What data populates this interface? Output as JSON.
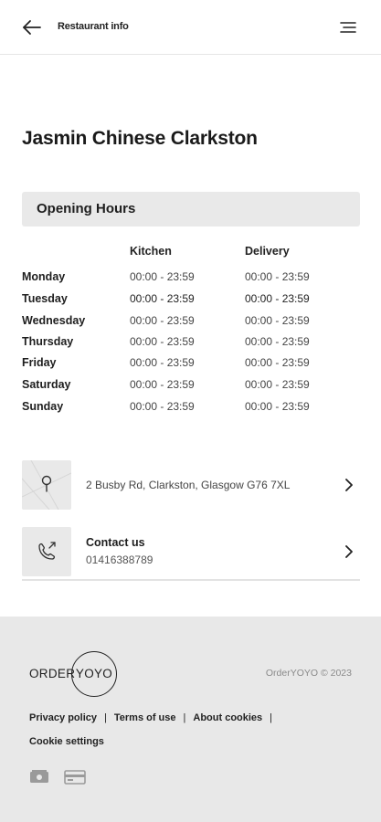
{
  "header": {
    "title": "Restaurant info",
    "back_icon": "arrow-left-icon",
    "menu_icon": "menu-icon"
  },
  "restaurant": {
    "name": "Jasmin Chinese Clarkston"
  },
  "opening_hours": {
    "heading": "Opening Hours",
    "columns": {
      "kitchen": "Kitchen",
      "delivery": "Delivery"
    },
    "days": [
      {
        "day": "Monday",
        "kitchen": "00:00 - 23:59",
        "delivery": "00:00 - 23:59"
      },
      {
        "day": "Tuesday",
        "kitchen": "00:00 - 23:59",
        "delivery": "00:00 - 23:59"
      },
      {
        "day": "Wednesday",
        "kitchen": "00:00 - 23:59",
        "delivery": "00:00 - 23:59"
      },
      {
        "day": "Thursday",
        "kitchen": "00:00 - 23:59",
        "delivery": "00:00 - 23:59"
      },
      {
        "day": "Friday",
        "kitchen": "00:00 - 23:59",
        "delivery": "00:00 - 23:59"
      },
      {
        "day": "Saturday",
        "kitchen": "00:00 - 23:59",
        "delivery": "00:00 - 23:59"
      },
      {
        "day": "Sunday",
        "kitchen": "00:00 - 23:59",
        "delivery": "00:00 - 23:59"
      }
    ]
  },
  "address": {
    "text": "2 Busby Rd, Clarkston, Glasgow G76 7XL",
    "icon": "map-pin-icon"
  },
  "contact": {
    "title": "Contact us",
    "phone": "01416388789",
    "icon": "phone-icon"
  },
  "footer": {
    "logo_left": "ORDER",
    "logo_right": "YOYO",
    "copyright": "OrderYOYO © 2023",
    "links": [
      "Privacy policy",
      "Terms of use",
      "About cookies"
    ],
    "separator": "|",
    "cookie_settings": "Cookie settings",
    "payment_icons": [
      "cash-icon",
      "card-icon"
    ]
  }
}
